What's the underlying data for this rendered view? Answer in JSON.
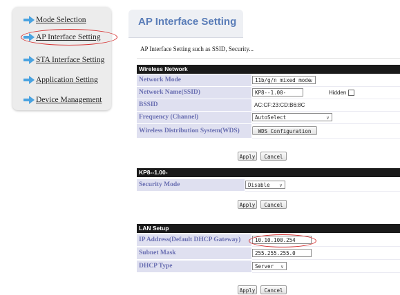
{
  "sidebar": {
    "items": [
      {
        "label": "Mode Selection"
      },
      {
        "label": "AP Interface Setting"
      },
      {
        "label": "STA Interface Setting"
      },
      {
        "label": "Application Setting"
      },
      {
        "label": "Device Management"
      }
    ],
    "selected_index": 1,
    "arrow_color": "#4aa3e0"
  },
  "header": {
    "title": "AP Interface Setting",
    "description": "AP Interface Setting such as SSID, Security..."
  },
  "wireless": {
    "heading": "Wireless Network",
    "rows": {
      "mode": {
        "label": "Network Mode",
        "value": "11b/g/n mixed mode"
      },
      "ssid": {
        "label": "Network Name(SSID)",
        "value": "KP8--1.00-",
        "hidden_label": "Hidden",
        "hidden_checked": false
      },
      "bssid": {
        "label": "BSSID",
        "value": "AC:CF:23:CD:B6:8C"
      },
      "freq": {
        "label": "Frequency (Channel)",
        "value": "AutoSelect"
      },
      "wds": {
        "label": "Wireless Distribution System(WDS)",
        "button": "WDS Configuration"
      }
    },
    "apply": "Apply",
    "cancel": "Cancel"
  },
  "security": {
    "heading": "KP8--1.00-",
    "mode": {
      "label": "Security Mode",
      "value": "Disable"
    },
    "apply": "Apply",
    "cancel": "Cancel"
  },
  "lan": {
    "heading": "LAN Setup",
    "ip": {
      "label": "IP Address(Default DHCP Gateway)",
      "value": "10.10.100.254"
    },
    "mask": {
      "label": "Subnet Mask",
      "value": "255.255.255.0"
    },
    "dhcp": {
      "label": "DHCP Type",
      "value": "Server"
    },
    "apply": "Apply",
    "cancel": "Cancel"
  },
  "colors": {
    "label_bg": "#dfe0f0",
    "label_text": "#6a6fb2",
    "header_title": "#5a7db8",
    "table_head": "#1a1a1a",
    "highlight_ring": "#d63030"
  }
}
